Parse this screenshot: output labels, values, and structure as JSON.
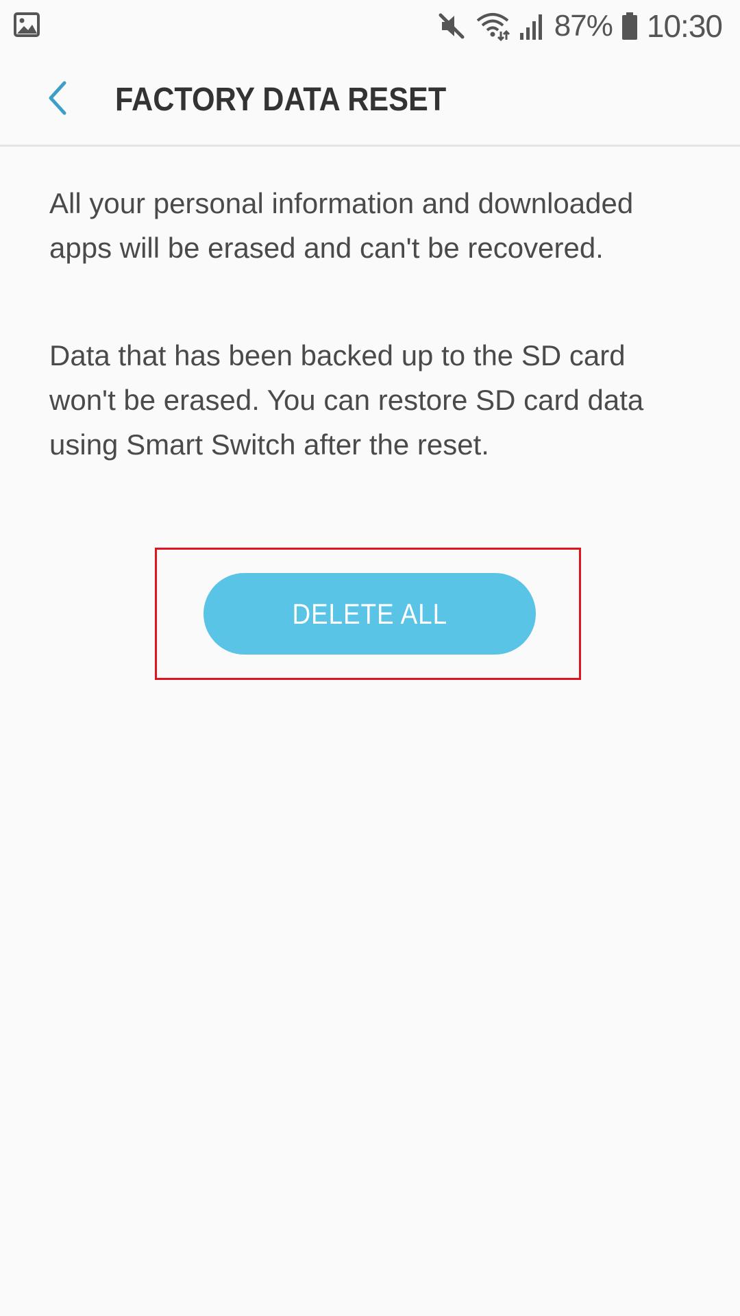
{
  "status_bar": {
    "battery_percent": "87%",
    "time": "10:30",
    "icons": [
      "gallery-icon",
      "mute-icon",
      "wifi-icon",
      "signal-icon",
      "battery-icon"
    ]
  },
  "app_bar": {
    "title": "FACTORY DATA RESET",
    "back_icon": "chevron-left-icon"
  },
  "content": {
    "paragraph_1": "All your personal information and downloaded apps will be erased and can't be recovered.",
    "paragraph_2": "Data that has been backed up to the SD card won't be erased. You can restore SD card data using Smart Switch after the reset."
  },
  "actions": {
    "delete_all_label": "DELETE ALL"
  },
  "colors": {
    "background": "#fafafa",
    "accent": "#5ac4e6",
    "back_chevron": "#3d9fc8",
    "highlight_border": "#e0141e",
    "title_text": "#333333",
    "body_text": "#4a4a4a"
  }
}
